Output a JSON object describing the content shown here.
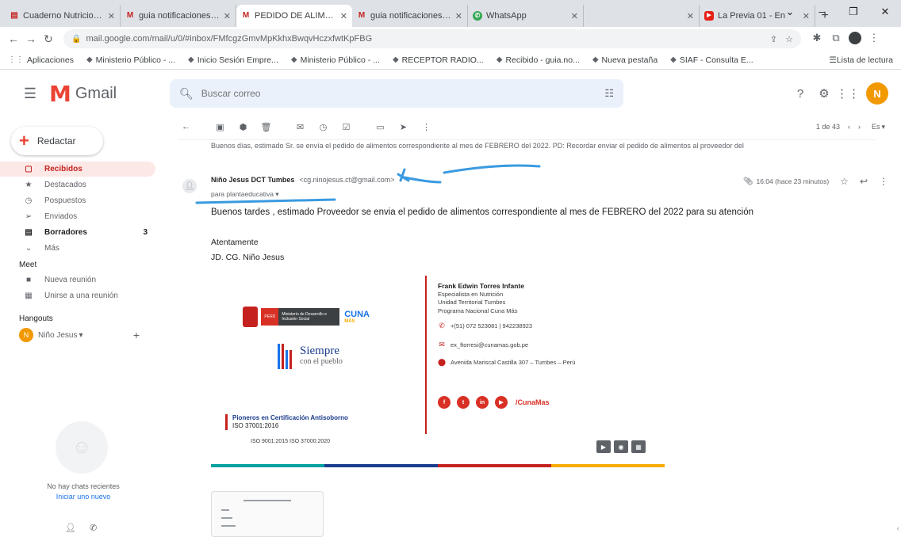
{
  "browser": {
    "tabs": [
      {
        "title": "Cuaderno Nutricional ni",
        "fav": "doc",
        "active": false
      },
      {
        "title": "guia notificaciones - gm",
        "fav": "M",
        "active": false
      },
      {
        "title": "PEDIDO DE ALIMENTOS",
        "fav": "M",
        "active": true
      },
      {
        "title": "guia notificaciones - gm",
        "fav": "M",
        "active": false
      },
      {
        "title": "WhatsApp",
        "fav": "wa",
        "active": false
      },
      {
        "title": "",
        "fav": "blank",
        "active": false
      },
      {
        "title": "La Previa 01 - En",
        "fav": "yt",
        "active": false
      }
    ],
    "win_controls": [
      "⌄",
      "–",
      "❐",
      "✕"
    ],
    "url": "mail.google.com/mail/u/0/#inbox/FMfcgzGmvMpKkhxBwqvHczxfwtKpFBG",
    "bookmarks": [
      "Aplicaciones",
      "Ministerio Público - ...",
      "Inicio Sesión Empre...",
      "Ministerio Público - ...",
      "RECEPTOR RADIO...",
      "Recibido - guia.no...",
      "Nueva pestaña",
      "SIAF - Consulta E..."
    ],
    "reading_list": "Lista de lectura"
  },
  "gmail": {
    "logo_text": "Gmail",
    "search_placeholder": "Buscar correo",
    "avatar_letter": "N",
    "compose_label": "Redactar",
    "nav": [
      {
        "label": "Recibidos",
        "icon": "▢",
        "active": true,
        "bold": false,
        "count": ""
      },
      {
        "label": "Destacados",
        "icon": "★",
        "active": false,
        "bold": false,
        "count": ""
      },
      {
        "label": "Pospuestos",
        "icon": "◷",
        "active": false,
        "bold": false,
        "count": ""
      },
      {
        "label": "Enviados",
        "icon": "➢",
        "active": false,
        "bold": false,
        "count": ""
      },
      {
        "label": "Borradores",
        "icon": "▤",
        "active": false,
        "bold": true,
        "count": "3"
      },
      {
        "label": "Más",
        "icon": "⌄",
        "active": false,
        "bold": false,
        "count": ""
      }
    ],
    "meet_label": "Meet",
    "meet_items": [
      {
        "label": "Nueva reunión",
        "icon": "■"
      },
      {
        "label": "Unirse a una reunión",
        "icon": "▦"
      }
    ],
    "hangouts_label": "Hangouts",
    "hangouts_user": "Niño Jesus",
    "hangouts_user_initial": "N",
    "hangouts_empty": "No hay chats recientes",
    "hangouts_link": "Iniciar uno nuevo",
    "pager": "1 de 43",
    "lang": "Es",
    "prev_snippet": "Buenos días, estimado Sr. se envía el pedido de alimentos correspondiente al mes de FEBRERO del 2022. PD: Recordar enviar el pedido de alimentos al proveedor del",
    "message": {
      "sender_name": "Niño Jesus DCT Tumbes",
      "sender_email": "<cg.ninojesus.ct@gmail.com>",
      "to": "para plantaeducativa",
      "time": "16:04 (hace 23 minutos)",
      "body": "Buenos tardes , estimado Proveedor se envia el pedido de alimentos correspondiente al mes de FEBRERO del 2022 para su atención",
      "closing": "Atentamente",
      "org": "JD. CG. Niño Jesus"
    },
    "signature": {
      "gov_label_1": "PERÚ",
      "gov_label_2": "Ministerio de Desarrollo e Inclusión Social",
      "cuna_label": "CUNA",
      "cuna_sub": "MÁS",
      "siempre_1": "Siempre",
      "siempre_2": "con el pueblo",
      "name": "Frank Edwin Torres Infante",
      "role": "Especialista en Nutrición",
      "unit": "Unidad Territorial Tumbes",
      "program": "Programa Nacional Cuna Más",
      "phone": "+(51) 072 523081 | 942238923",
      "email": "ex_ftorresi@cunamas.gob.pe",
      "address": "Avenida Mariscal Castilla 307 – Tumbes – Perú",
      "social_icons": [
        "f",
        "t",
        "in",
        "▶"
      ],
      "hashtag": "/CunaMas",
      "cert_title": "Pioneros en Certificación Antisoborno",
      "cert_iso": "ISO 37001:2016",
      "cert_others": "ISO 9001:2015   ISO 37000:2020",
      "bar_colors": [
        "#00a0a0",
        "#1a3c8c",
        "#c5221f",
        "#f9ab00"
      ]
    }
  }
}
